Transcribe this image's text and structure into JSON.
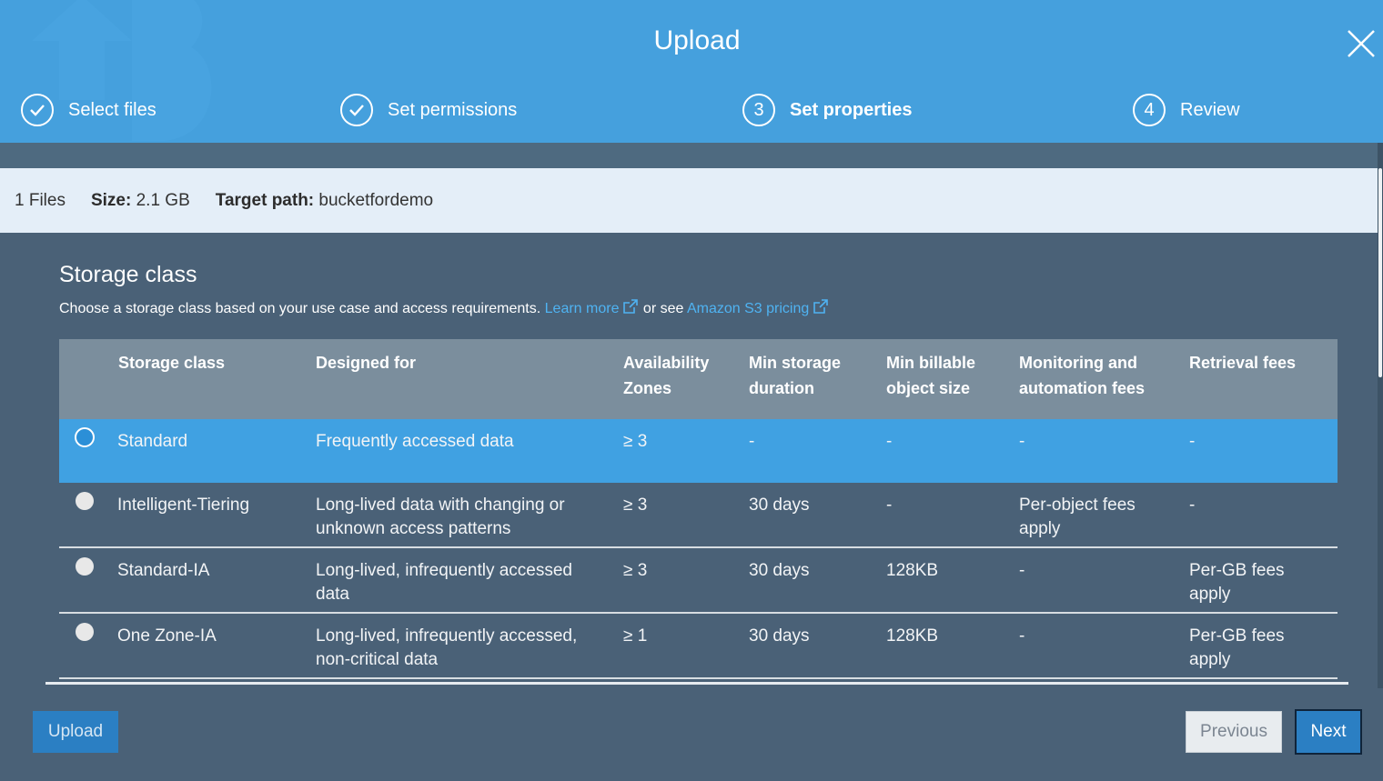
{
  "header": {
    "title": "Upload",
    "steps": [
      {
        "label": "Select files",
        "state": "done"
      },
      {
        "label": "Set permissions",
        "state": "done"
      },
      {
        "label": "Set properties",
        "number": "3",
        "state": "active"
      },
      {
        "label": "Review",
        "number": "4",
        "state": "pending"
      }
    ]
  },
  "info": {
    "files": "1 Files",
    "size_label": "Size:",
    "size_value": "2.1 GB",
    "target_label": "Target path:",
    "target_value": "bucketfordemo"
  },
  "storage": {
    "title": "Storage class",
    "description": "Choose a storage class based on your use case and access requirements.",
    "learn_more": "Learn more",
    "or_see": "or see",
    "pricing_link": "Amazon S3 pricing",
    "columns": {
      "storage_class": "Storage class",
      "designed_for": "Designed for",
      "az_line1": "Availability",
      "az_line2": "Zones",
      "min_dur_line1": "Min storage",
      "min_dur_line2": "duration",
      "min_size_line1": "Min billable",
      "min_size_line2": "object size",
      "mon_line1": "Monitoring and",
      "mon_line2": "automation fees",
      "retrieval": "Retrieval fees"
    },
    "rows": [
      {
        "name": "Standard",
        "designed_line1": "Frequently accessed data",
        "designed_line2": "",
        "az": "≥ 3",
        "min_duration": "-",
        "min_size": "-",
        "monitoring_line1": "-",
        "monitoring_line2": "",
        "retrieval_line1": "-",
        "retrieval_line2": "",
        "selected": true
      },
      {
        "name": "Intelligent-Tiering",
        "designed_line1": "Long-lived data with changing or",
        "designed_line2": "unknown access patterns",
        "az": "≥ 3",
        "min_duration": "30 days",
        "min_size": "-",
        "monitoring_line1": "Per-object fees",
        "monitoring_line2": "apply",
        "retrieval_line1": "-",
        "retrieval_line2": "",
        "selected": false
      },
      {
        "name": "Standard-IA",
        "designed_line1": "Long-lived, infrequently accessed",
        "designed_line2": "data",
        "az": "≥ 3",
        "min_duration": "30 days",
        "min_size": "128KB",
        "monitoring_line1": "-",
        "monitoring_line2": "",
        "retrieval_line1": "Per-GB fees",
        "retrieval_line2": "apply",
        "selected": false
      },
      {
        "name": "One Zone-IA",
        "designed_line1": "Long-lived, infrequently accessed,",
        "designed_line2": "non-critical data",
        "az": "≥ 1",
        "min_duration": "30 days",
        "min_size": "128KB",
        "monitoring_line1": "-",
        "monitoring_line2": "",
        "retrieval_line1": "Per-GB fees",
        "retrieval_line2": "apply",
        "selected": false
      }
    ]
  },
  "footer": {
    "upload": "Upload",
    "previous": "Previous",
    "next": "Next"
  },
  "colors": {
    "header": "#45a0dd",
    "selected_row": "#40a1e2",
    "link": "#4fb3f2",
    "primary_button": "#2b7fc3"
  }
}
